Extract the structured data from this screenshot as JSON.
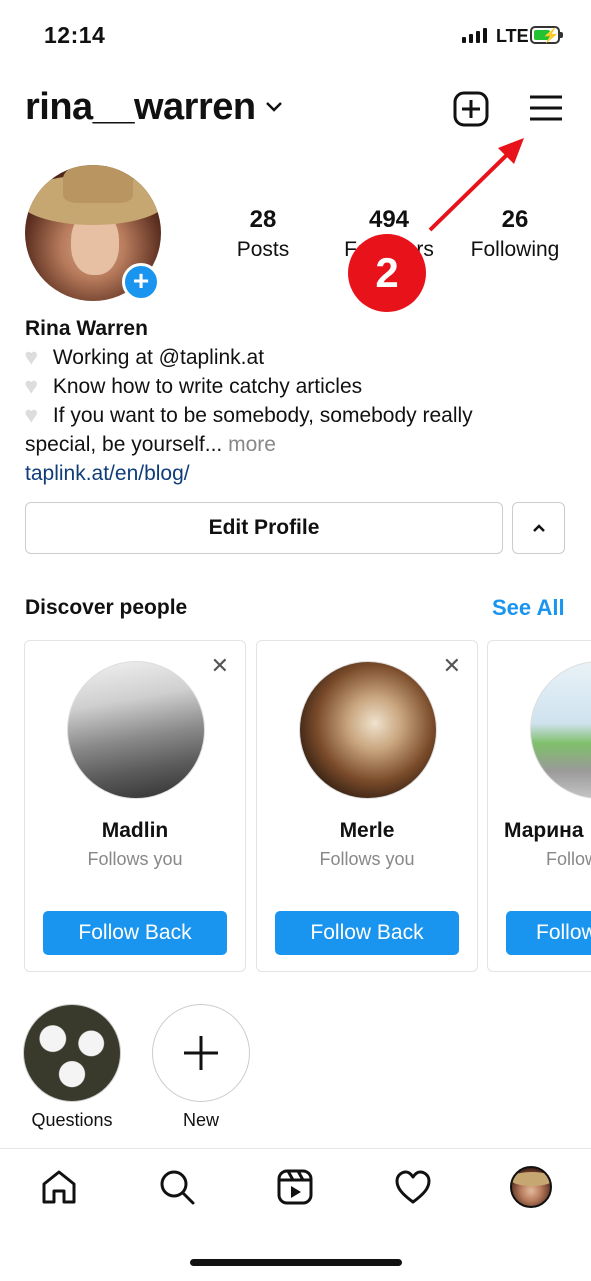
{
  "status_bar": {
    "time": "12:14",
    "network": "LTE"
  },
  "header": {
    "username": "rina__warren"
  },
  "stats": [
    {
      "value": "28",
      "label": "Posts"
    },
    {
      "value": "494",
      "label": "Followers"
    },
    {
      "value": "26",
      "label": "Following"
    }
  ],
  "bio": {
    "name": "Rina Warren",
    "line1": "Working at @taplink.at",
    "line2": "Know how to write catchy articles",
    "line3a": "If you want to be somebody, somebody really",
    "line3b": "special, be yourself...",
    "more": "more",
    "link": "taplink.at/en/blog/"
  },
  "actions": {
    "edit_profile": "Edit Profile"
  },
  "discover": {
    "title": "Discover people",
    "see_all": "See All",
    "cards": [
      {
        "name": "Madlin",
        "subtitle": "Follows you",
        "button": "Follow Back"
      },
      {
        "name": "Merle",
        "subtitle": "Follows you",
        "button": "Follow Back"
      },
      {
        "name": "Марина",
        "subtitle": "Follows you",
        "button": "Follow Back"
      }
    ]
  },
  "highlights": [
    {
      "label": "Questions"
    },
    {
      "label": "New"
    }
  ],
  "annotation": {
    "number": "2",
    "color": "#e8121a"
  },
  "colors": {
    "accent": "#1a95ef",
    "link": "#0f3d79"
  }
}
